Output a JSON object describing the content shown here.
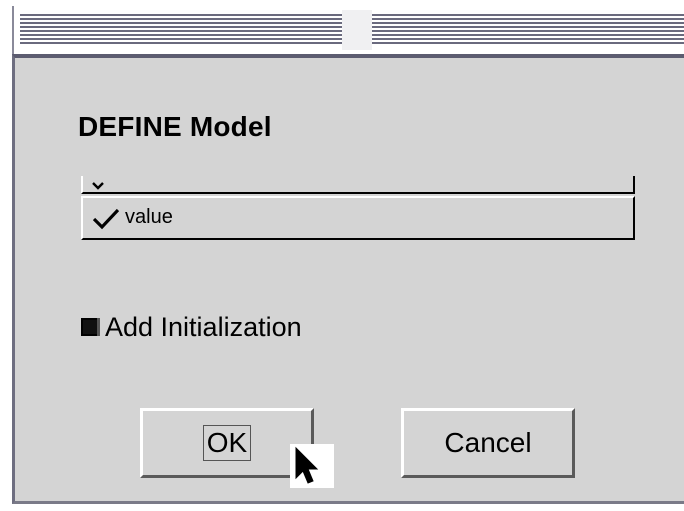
{
  "dialog": {
    "title": "DEFINE Model",
    "combo": {
      "selected_value": "value",
      "caret_icon": "chevron-down-icon",
      "check_icon": "checkmark-icon"
    },
    "add_initialization": {
      "label": "Add Initialization",
      "checked": true
    },
    "buttons": {
      "ok_label": "OK",
      "cancel_label": "Cancel"
    }
  },
  "colors": {
    "dialog_background": "#d4d4d4",
    "titlebar_lines": "#6a6a7e"
  }
}
